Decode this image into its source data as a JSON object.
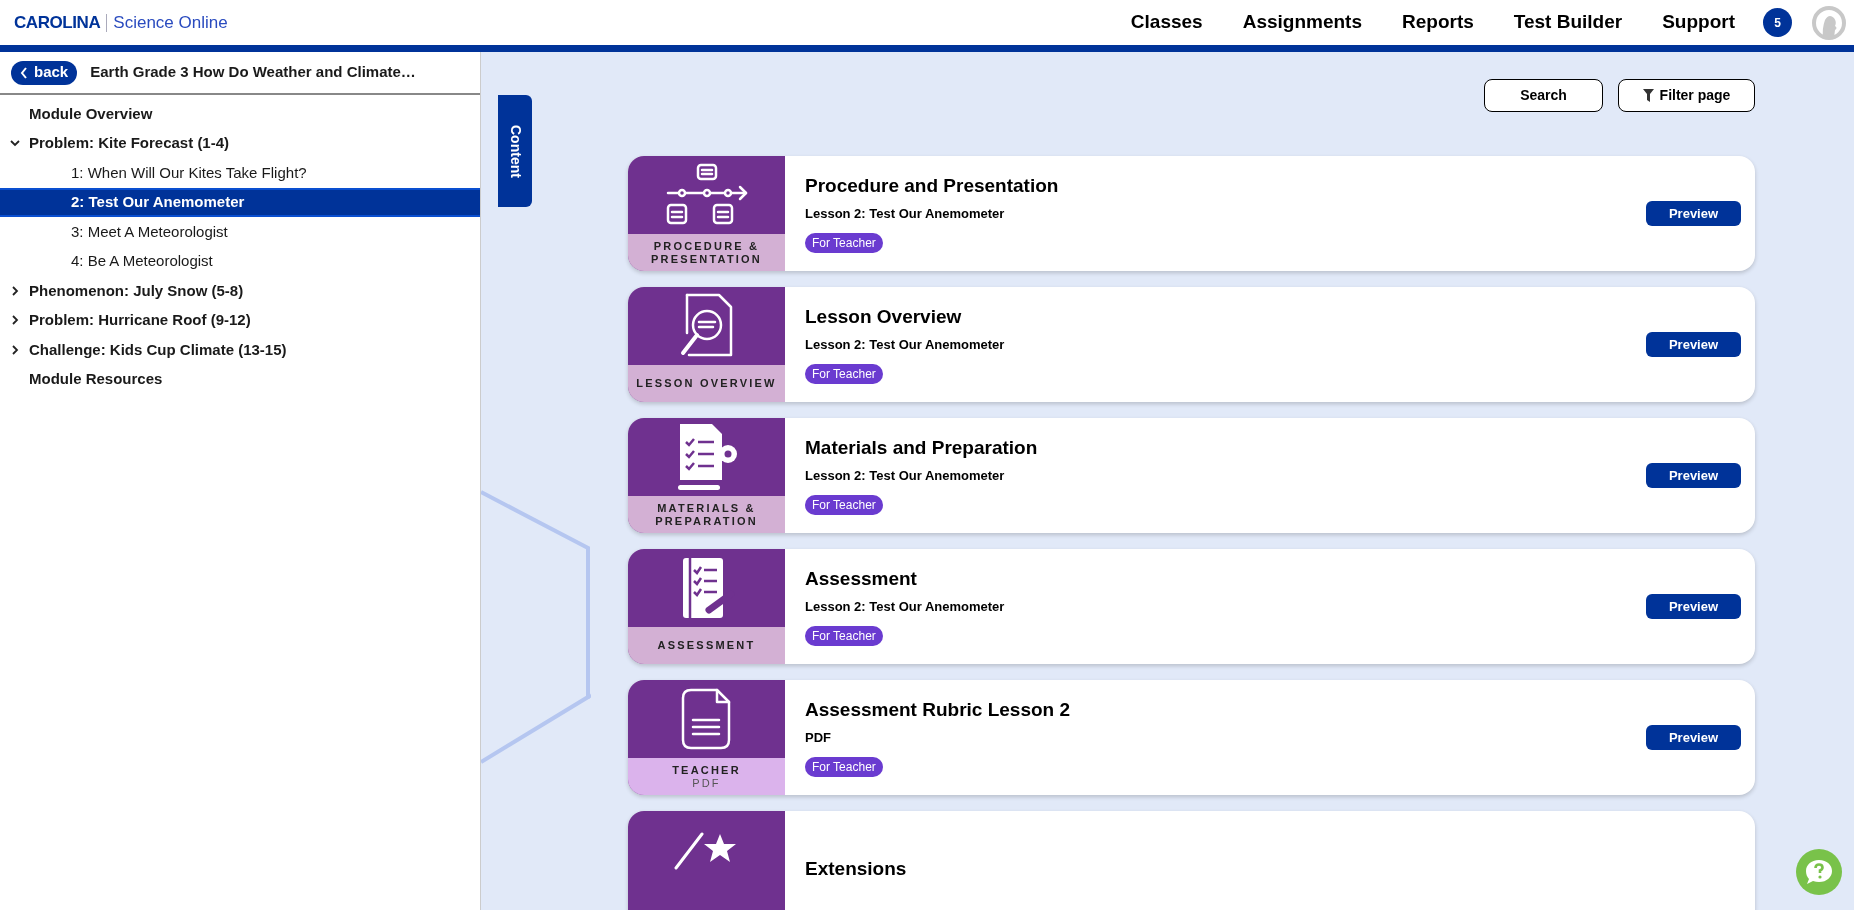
{
  "header": {
    "logo": {
      "brand": "CAROLINA",
      "product": "Science Online"
    },
    "nav": [
      "Classes",
      "Assignments",
      "Reports",
      "Test Builder",
      "Support"
    ],
    "notification_count": "5"
  },
  "sidebar": {
    "back_button": "back",
    "title": "Earth Grade 3 How Do Weather and Climate…",
    "items": [
      {
        "label": "Module Overview",
        "selected": false
      },
      {
        "label": "Problem: Kite Forecast (1-4)",
        "selected": false,
        "expanded": true,
        "children": [
          {
            "label": "1: When Will Our Kites Take Flight?",
            "selected": false
          },
          {
            "label": "2: Test Our Anemometer",
            "selected": true
          },
          {
            "label": "3: Meet A Meteorologist",
            "selected": false
          },
          {
            "label": "4: Be A Meteorologist",
            "selected": false
          }
        ]
      },
      {
        "label": "Phenomenon: July Snow (5-8)",
        "selected": false,
        "expanded": false
      },
      {
        "label": "Problem: Hurricane Roof (9-12)",
        "selected": false,
        "expanded": false
      },
      {
        "label": "Challenge: Kids Cup Climate (13-15)",
        "selected": false,
        "expanded": false
      },
      {
        "label": "Module Resources",
        "selected": false
      }
    ]
  },
  "content_tab": "Content",
  "toolbar": {
    "search_button": "Search",
    "filter_button": "Filter page"
  },
  "cards": [
    {
      "kind": "procedure",
      "thumb_label": [
        "PROCEDURE &",
        "PRESENTATION"
      ],
      "title": "Procedure and Presentation",
      "subtitle": "Lesson 2: Test Our Anemometer",
      "tag": "For Teacher",
      "button": "Preview"
    },
    {
      "kind": "overview",
      "thumb_label": [
        "LESSON OVERVIEW"
      ],
      "title": "Lesson Overview",
      "subtitle": "Lesson 2: Test Our Anemometer",
      "tag": "For Teacher",
      "button": "Preview"
    },
    {
      "kind": "materials",
      "thumb_label": [
        "MATERIALS &",
        "PREPARATION"
      ],
      "title": "Materials and Preparation",
      "subtitle": "Lesson 2: Test Our Anemometer",
      "tag": "For Teacher",
      "button": "Preview"
    },
    {
      "kind": "assessment",
      "thumb_label": [
        "ASSESSMENT"
      ],
      "title": "Assessment",
      "subtitle": "Lesson 2: Test Our Anemometer",
      "tag": "For Teacher",
      "button": "Preview"
    },
    {
      "kind": "document",
      "thumb_label": [
        "TEACHER",
        "PDF"
      ],
      "title": "Assessment Rubric Lesson 2",
      "subtitle": "PDF",
      "tag": "For Teacher",
      "button": "Preview"
    },
    {
      "kind": "extension",
      "title": "Extensions"
    }
  ]
}
